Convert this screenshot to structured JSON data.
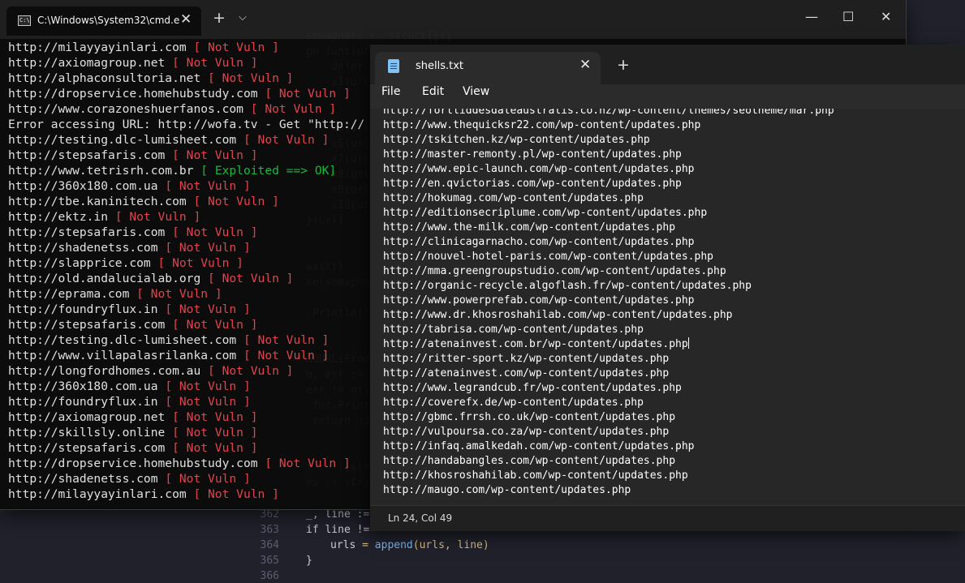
{
  "editor": {
    "gutter": [
      "362",
      "363",
      "364",
      "365",
      "366"
    ],
    "code_lines": [
      {
        "row": 0,
        "text": "semaphore <- struct{}{}"
      },
      {
        "row": 1,
        "text": "go func(url"
      },
      {
        "row": 2,
        "text": "    defer"
      },
      {
        "row": 3,
        "text": "    x1(url"
      },
      {
        "row": 6,
        "text": "    x5(url"
      },
      {
        "row": 7,
        "text": "    x6(url"
      },
      {
        "row": 8,
        "text": "    x7(url"
      },
      {
        "row": 9,
        "text": "    x8(url"
      },
      {
        "row": 10,
        "text": "    x9(url"
      },
      {
        "row": 11,
        "text": "    x10(url"
      },
      {
        "row": 12,
        "text": "}(url)"
      },
      {
        "row": 15,
        "text": "wait()"
      },
      {
        "row": 16,
        "text": "se(semapho"
      },
      {
        "row": 18,
        "text": ".Println(\"Do"
      },
      {
        "row": 21,
        "text": "adURLsFromF"
      },
      {
        "row": 22,
        "text": "a, err := i"
      },
      {
        "row": 23,
        "text": "err != nil"
      },
      {
        "row": 24,
        "text": " fmt.Printl"
      },
      {
        "row": 25,
        "text": " return nil"
      },
      {
        "row": 28,
        "text": "s := []stri"
      },
      {
        "row": 29,
        "text": "es := strin"
      }
    ],
    "bottom_code": {
      "line362": "_, line :=",
      "line363": "if line !=",
      "line364_a": "urls",
      "line364_b": "append",
      "line364_c": "(urls, line)",
      "line365": "}"
    }
  },
  "cmd": {
    "tab_title": "C:\\Windows\\System32\\cmd.e",
    "tab_close": "✕",
    "new_tab": "+",
    "dropdown": "⌵",
    "minimize": "—",
    "maximize": "☐",
    "close": "✕",
    "lines": [
      {
        "url": "http://milayyayinlari.com",
        "status": "[ Not Vuln ]",
        "kind": "red"
      },
      {
        "url": "http://axiomagroup.net",
        "status": "[ Not Vuln ]",
        "kind": "red"
      },
      {
        "url": "http://alphaconsultoria.net",
        "status": "[ Not Vuln ]",
        "kind": "red"
      },
      {
        "url": "http://dropservice.homehubstudy.com",
        "status": "[ Not Vuln ]",
        "kind": "red"
      },
      {
        "url": "http://www.corazoneshuerfanos.com",
        "status": "[ Not Vuln ]",
        "kind": "red"
      },
      {
        "url": "Error accessing URL: http://wofa.tv - Get \"http://",
        "status": "",
        "kind": "plain"
      },
      {
        "url": "http://testing.dlc-lumisheet.com",
        "status": "[ Not Vuln ]",
        "kind": "red"
      },
      {
        "url": "http://stepsafaris.com",
        "status": "[ Not Vuln ]",
        "kind": "red"
      },
      {
        "url": "http://www.tetrisrh.com.br",
        "status": "[ Exploited ==> OK]",
        "kind": "green"
      },
      {
        "url": "http://360x180.com.ua",
        "status": "[ Not Vuln ]",
        "kind": "red"
      },
      {
        "url": "http://tbe.kaninitech.com",
        "status": "[ Not Vuln ]",
        "kind": "red"
      },
      {
        "url": "http://ektz.in",
        "status": "[ Not Vuln ]",
        "kind": "red"
      },
      {
        "url": "http://stepsafaris.com",
        "status": "[ Not Vuln ]",
        "kind": "red"
      },
      {
        "url": "http://shadenetss.com",
        "status": "[ Not Vuln ]",
        "kind": "red"
      },
      {
        "url": "http://slapprice.com",
        "status": "[ Not Vuln ]",
        "kind": "red"
      },
      {
        "url": "http://old.andalucialab.org",
        "status": "[ Not Vuln ]",
        "kind": "red"
      },
      {
        "url": "http://eprama.com",
        "status": "[ Not Vuln ]",
        "kind": "red"
      },
      {
        "url": "http://foundryflux.in",
        "status": "[ Not Vuln ]",
        "kind": "red"
      },
      {
        "url": "http://stepsafaris.com",
        "status": "[ Not Vuln ]",
        "kind": "red"
      },
      {
        "url": "http://testing.dlc-lumisheet.com",
        "status": "[ Not Vuln ]",
        "kind": "red"
      },
      {
        "url": "http://www.villapalasrilanka.com",
        "status": "[ Not Vuln ]",
        "kind": "red"
      },
      {
        "url": "http://longfordhomes.com.au",
        "status": "[ Not Vuln ]",
        "kind": "red"
      },
      {
        "url": "http://360x180.com.ua",
        "status": "[ Not Vuln ]",
        "kind": "red"
      },
      {
        "url": "http://foundryflux.in",
        "status": "[ Not Vuln ]",
        "kind": "red"
      },
      {
        "url": "http://axiomagroup.net",
        "status": "[ Not Vuln ]",
        "kind": "red"
      },
      {
        "url": "http://skillsly.online",
        "status": "[ Not Vuln ]",
        "kind": "red"
      },
      {
        "url": "http://stepsafaris.com",
        "status": "[ Not Vuln ]",
        "kind": "red"
      },
      {
        "url": "http://dropservice.homehubstudy.com",
        "status": "[ Not Vuln ]",
        "kind": "red"
      },
      {
        "url": "http://shadenetss.com",
        "status": "[ Not Vuln ]",
        "kind": "red"
      },
      {
        "url": "http://milayyayinlari.com",
        "status": "[ Not Vuln ]",
        "kind": "red"
      }
    ]
  },
  "notepad": {
    "tab_title": "shells.txt",
    "tab_close": "✕",
    "new_tab": "+",
    "menu": [
      "File",
      "Edit",
      "View"
    ],
    "status_position": "Ln 24, Col 49",
    "lines": [
      "http://fortliddesdaleaustralis.co.nz/wp-content/themes/seotheme/mar.php",
      "http://www.thequicksr22.com/wp-content/updates.php",
      "http://tskitchen.kz/wp-content/updates.php",
      "http://master-remonty.pl/wp-content/updates.php",
      "http://www.epic-launch.com/wp-content/updates.php",
      "http://en.qvictorias.com/wp-content/updates.php",
      "http://hokumag.com/wp-content/updates.php",
      "http://editionsecriplume.com/wp-content/updates.php",
      "http://www.the-milk.com/wp-content/updates.php",
      "http://clinicagarnacho.com/wp-content/updates.php",
      "http://nouvel-hotel-paris.com/wp-content/updates.php",
      "http://mma.greengroupstudio.com/wp-content/updates.php",
      "http://organic-recycle.algoflash.fr/wp-content/updates.php",
      "http://www.powerprefab.com/wp-content/updates.php",
      "http://www.dr.khosroshahilab.com/wp-content/updates.php",
      "http://tabrisa.com/wp-content/updates.php",
      "http://atenainvest.com.br/wp-content/updates.php",
      "http://ritter-sport.kz/wp-content/updates.php",
      "http://atenainvest.com/wp-content/updates.php",
      "http://www.legrandcub.fr/wp-content/updates.php",
      "http://coverefx.de/wp-content/updates.php",
      "http://gbmc.frrsh.co.uk/wp-content/updates.php",
      "http://vulpoursa.co.za/wp-content/updates.php",
      "http://infaq.amalkedah.com/wp-content/updates.php",
      "http://handabangles.com/wp-content/updates.php",
      "http://khosroshahilab.com/wp-content/updates.php",
      "http://maugo.com/wp-content/updates.php"
    ],
    "caret_line": 16
  }
}
